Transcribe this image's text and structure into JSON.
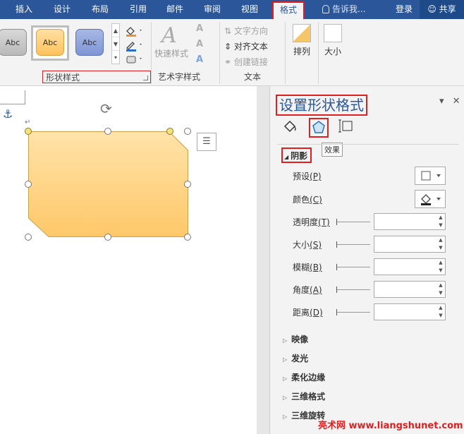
{
  "menu": {
    "tabs": [
      {
        "label": "插入"
      },
      {
        "label": "设计"
      },
      {
        "label": "布局"
      },
      {
        "label": "引用"
      },
      {
        "label": "邮件"
      },
      {
        "label": "审阅"
      },
      {
        "label": "视图"
      },
      {
        "label": "格式",
        "active": true
      }
    ],
    "tell_me": "告诉我...",
    "login": "登录",
    "share": "共享"
  },
  "ribbon": {
    "shape_styles": {
      "thumbs": [
        "Abc",
        "Abc",
        "Abc"
      ],
      "label": "形状样式"
    },
    "wordart": {
      "quick_styles": "快速样式",
      "label": "艺术字样式"
    },
    "text": {
      "direction": "文字方向",
      "align": "对齐文本",
      "link": "创建链接",
      "label": "文本"
    },
    "arrange": "排列",
    "size": "大小"
  },
  "pane": {
    "title": "设置形状格式",
    "tooltip": "效果",
    "shadow": {
      "heading": "阴影",
      "preset": {
        "text": "预设",
        "key": "(P)"
      },
      "color": {
        "text": "颜色",
        "key": "(C)"
      },
      "transparency": {
        "text": "透明度",
        "key": "(T)"
      },
      "size": {
        "text": "大小",
        "key": "(S)"
      },
      "blur": {
        "text": "模糊",
        "key": "(B)"
      },
      "angle": {
        "text": "角度",
        "key": "(A)"
      },
      "distance": {
        "text": "距离",
        "key": "(D)"
      }
    },
    "sections": [
      "映像",
      "发光",
      "柔化边缘",
      "三维格式",
      "三维旋转"
    ]
  },
  "watermark": "亮术网 www.liangshunet.com",
  "colors": {
    "accent": "#2b579a",
    "highlight": "#e02020",
    "shape_fill": "#ffc86a"
  }
}
